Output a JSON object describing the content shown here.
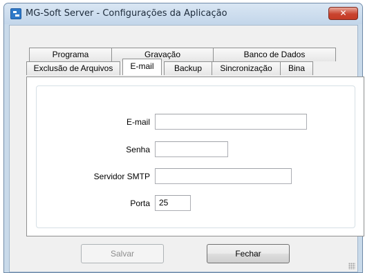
{
  "window": {
    "title": "MG-Soft Server - Configurações da Aplicação",
    "close_label": "✕"
  },
  "tabs_row1": [
    {
      "label": "Programa"
    },
    {
      "label": "Gravação"
    },
    {
      "label": "Banco de Dados"
    }
  ],
  "tabs_row2": [
    {
      "label": "Exclusão de Arquivos"
    },
    {
      "label": "E-mail",
      "active": true
    },
    {
      "label": "Backup"
    },
    {
      "label": "Sincronização"
    },
    {
      "label": "Bina"
    }
  ],
  "form": {
    "email_label": "E-mail",
    "email_value": "",
    "password_label": "Senha",
    "password_value": "",
    "smtp_label": "Servidor SMTP",
    "smtp_value": "",
    "port_label": "Porta",
    "port_value": "25"
  },
  "buttons": {
    "save_label": "Salvar",
    "save_enabled": false,
    "close_label": "Fechar"
  }
}
